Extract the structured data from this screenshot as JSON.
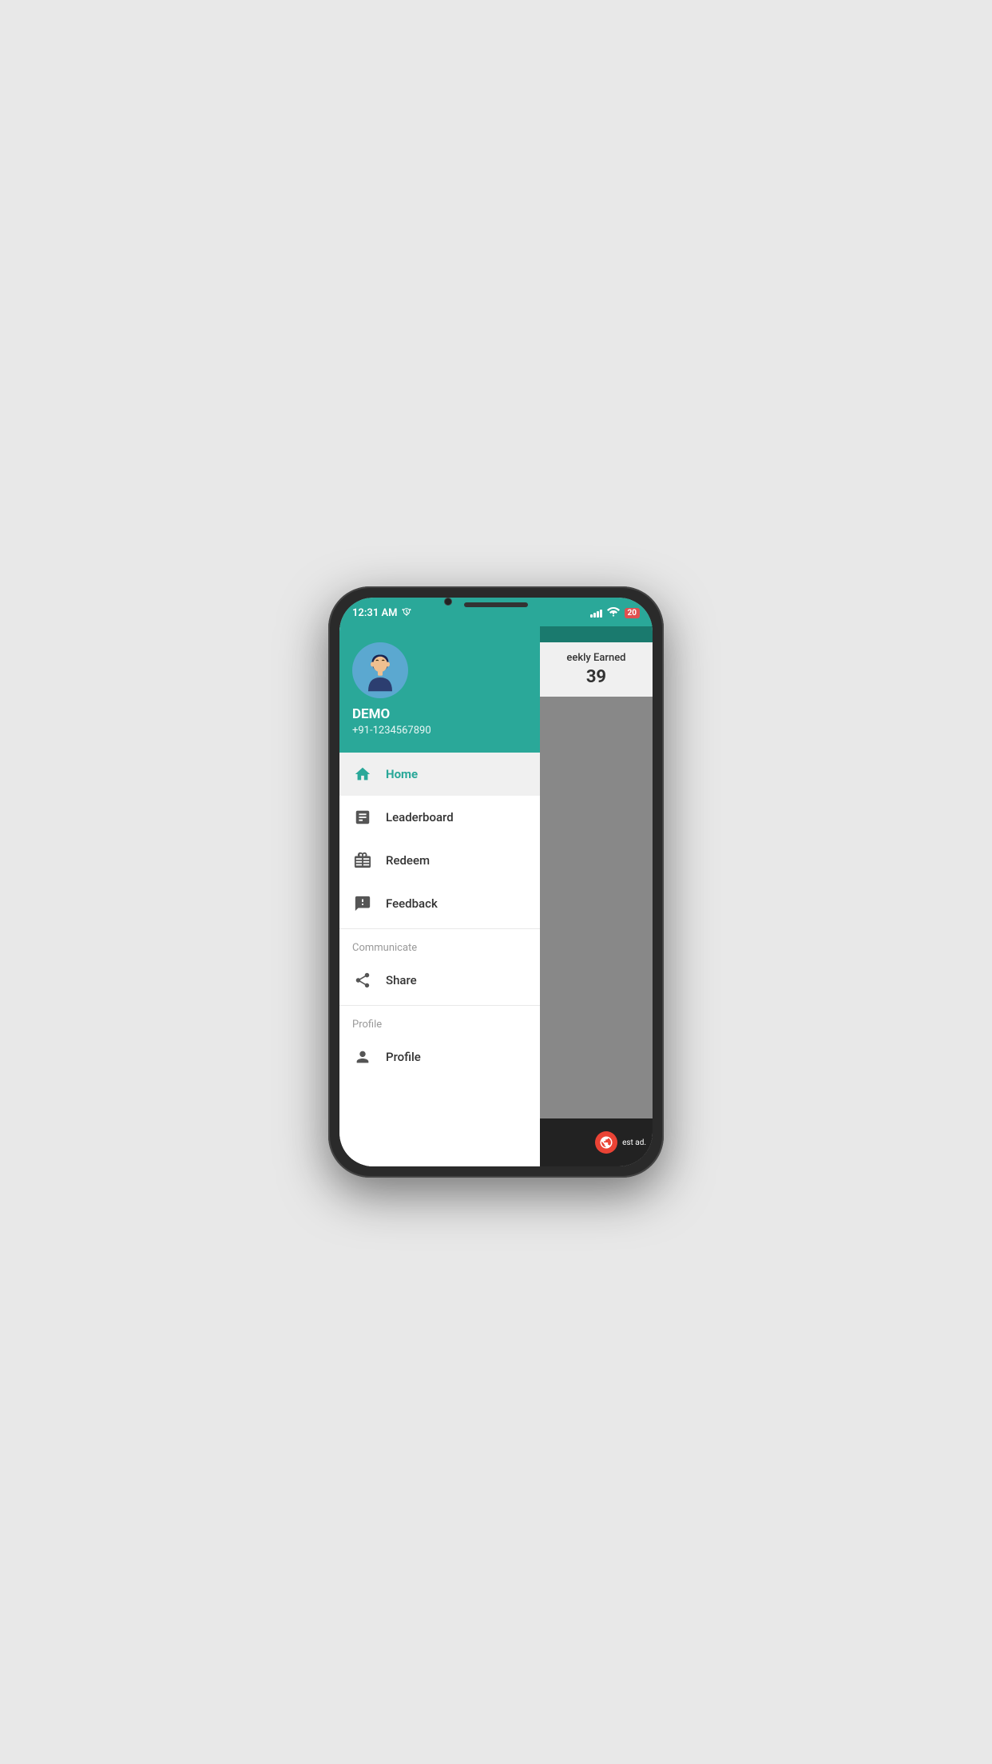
{
  "phone": {
    "status_bar": {
      "time": "12:31 AM",
      "battery_level": "20"
    },
    "drawer": {
      "user": {
        "name": "DEMO",
        "phone": "+91-1234567890"
      },
      "menu_items": [
        {
          "id": "home",
          "label": "Home",
          "icon": "home-icon",
          "active": true
        },
        {
          "id": "leaderboard",
          "label": "Leaderboard",
          "icon": "leaderboard-icon",
          "active": false
        },
        {
          "id": "redeem",
          "label": "Redeem",
          "icon": "redeem-icon",
          "active": false
        },
        {
          "id": "feedback",
          "label": "Feedback",
          "icon": "feedback-icon",
          "active": false
        }
      ],
      "communicate_section": {
        "label": "Communicate",
        "items": [
          {
            "id": "share",
            "label": "Share",
            "icon": "share-icon"
          }
        ]
      },
      "profile_section": {
        "label": "Profile",
        "items": [
          {
            "id": "profile",
            "label": "Profile",
            "icon": "profile-icon"
          }
        ]
      }
    },
    "right_panel": {
      "weekly_earned_label": "eekly Earned",
      "weekly_earned_value": "39",
      "ad_text": "est ad."
    }
  }
}
